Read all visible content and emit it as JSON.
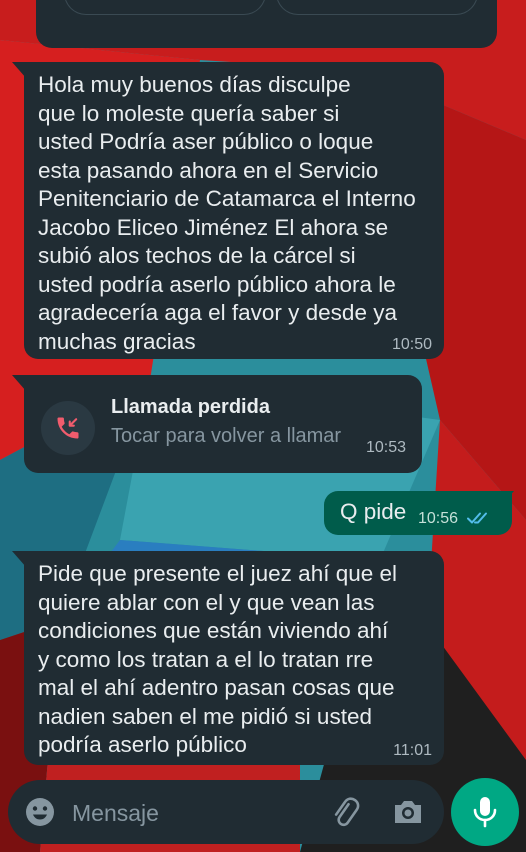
{
  "messages": [
    {
      "text": "Hola muy buenos días disculpe\nque lo moleste quería saber si\nusted Podría aser público o loque\nesta pasando ahora en el Servicio\nPenitenciario de Catamarca el Interno\nJacobo Eliceo Jiménez El ahora se\nsubió alos techos de la cárcel si\nusted podría aserlo público ahora le\nagradecería aga el favor y desde ya\nmuchas gracias",
      "time": "10:50"
    },
    {
      "text": "Q pide",
      "time": "10:56",
      "status_icon": "double-check-read-icon"
    },
    {
      "text": "Pide que presente el juez ahí que el\nquiere ablar con el y que vean las\ncondiciones que están viviendo ahí\ny como los tratan a el lo tratan rre\nmal el ahí adentro pasan cosas que\nnadien saben el me pidió si usted\npodría aserlo público",
      "time": "11:01"
    }
  ],
  "missed_call": {
    "title": "Llamada perdida",
    "subtitle": "Tocar para volver a llamar",
    "time": "10:53",
    "icon": "missed-call-icon"
  },
  "input": {
    "placeholder": "Mensaje",
    "icons": [
      "emoji-icon",
      "attach-icon",
      "camera-icon",
      "mic-icon"
    ]
  },
  "colors": {
    "incoming_bubble": "#202c33",
    "outgoing_bubble": "#005c4b",
    "accent": "#00a884",
    "missed_call_red": "#f15c6d",
    "read_check": "#53bdeb"
  }
}
